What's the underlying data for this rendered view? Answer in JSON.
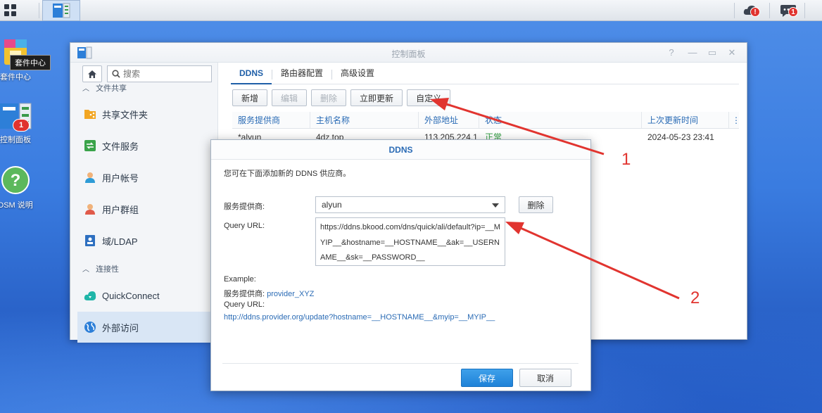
{
  "taskbar": {
    "cloud_badge": "!",
    "notify_badge": "1"
  },
  "desktop": {
    "icons": [
      {
        "label": "套件中心"
      },
      {
        "label": "控制面板",
        "badge": "1"
      },
      {
        "label": "DSM 说明"
      }
    ],
    "tooltip": "套件中心"
  },
  "window": {
    "title": "控制面板",
    "sidebar": {
      "search_placeholder": "搜索",
      "section_file_sharing": "文件共享",
      "section_connectivity": "连接性",
      "items": [
        {
          "label": "共享文件夹",
          "icon": "share-folder-icon"
        },
        {
          "label": "文件服务",
          "icon": "file-service-icon"
        },
        {
          "label": "用户帐号",
          "icon": "user-icon"
        },
        {
          "label": "用户群组",
          "icon": "group-icon"
        },
        {
          "label": "域/LDAP",
          "icon": "ldap-icon"
        },
        {
          "label": "QuickConnect",
          "icon": "quickconnect-icon"
        },
        {
          "label": "外部访问",
          "icon": "globe-icon"
        }
      ]
    },
    "tabs": [
      "DDNS",
      "路由器配置",
      "高级设置"
    ],
    "toolbar": {
      "add": "新增",
      "edit": "编辑",
      "delete": "删除",
      "update_now": "立即更新",
      "customize": "自定义"
    },
    "grid": {
      "headers": [
        "服务提供商",
        "主机名称",
        "外部地址",
        "状态",
        "上次更新时间"
      ],
      "rows": [
        [
          "*alyun",
          "4dz.top",
          "113.205.224.1",
          "正常",
          "2024-05-23 23:41"
        ]
      ]
    }
  },
  "dialog": {
    "title": "DDNS",
    "intro": "您可在下面添加新的 DDNS 供应商。",
    "provider_label": "服务提供商:",
    "provider_value": "alyun",
    "delete_button": "删除",
    "query_url_label": "Query URL:",
    "query_url_value": "https://ddns.bkood.com/dns/quick/ali/default?ip=__MYIP__&hostname=__HOSTNAME__&ak=__USERNAME__&sk=__PASSWORD__",
    "example_title": "Example:",
    "example_provider_label": "服务提供商:",
    "example_provider_value": "provider_XYZ",
    "example_url_label": "Query URL:",
    "example_url_value": "http://ddns.provider.org/update?hostname=__HOSTNAME__&myip=__MYIP__",
    "save_button": "保存",
    "cancel_button": "取消"
  },
  "annotations": {
    "label_1": "1",
    "label_2": "2",
    "color": "#e1342f"
  }
}
